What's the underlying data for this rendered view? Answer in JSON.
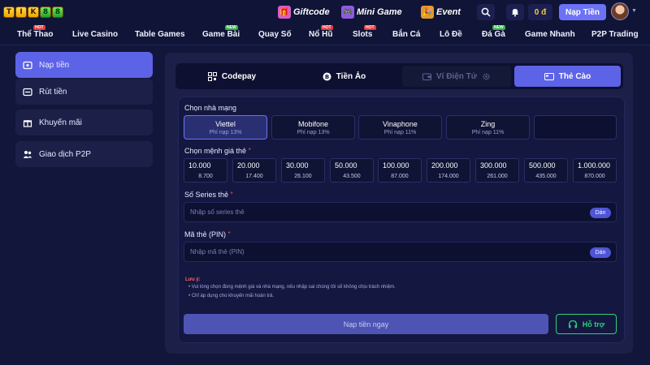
{
  "header": {
    "logo_letters": [
      "T",
      "I",
      "K",
      "8",
      "8"
    ],
    "promos": [
      {
        "label": "Giftcode",
        "icon": "gift-icon"
      },
      {
        "label": "Mini Game",
        "icon": "arcade-icon"
      },
      {
        "label": "Event",
        "icon": "event-icon"
      }
    ],
    "balance": "0 đ",
    "deposit_label": "Nạp Tiền"
  },
  "nav": {
    "items": [
      {
        "label": "Thể Thao",
        "badge": "HOT"
      },
      {
        "label": "Live Casino",
        "badge": ""
      },
      {
        "label": "Table Games",
        "badge": ""
      },
      {
        "label": "Game Bài",
        "badge": "NEW"
      },
      {
        "label": "Quay Số",
        "badge": ""
      },
      {
        "label": "Nổ Hũ",
        "badge": "HOT"
      },
      {
        "label": "Slots",
        "badge": "HOT"
      },
      {
        "label": "Bắn Cá",
        "badge": ""
      },
      {
        "label": "Lô Đề",
        "badge": ""
      },
      {
        "label": "Đá Gà",
        "badge": "NEW"
      },
      {
        "label": "Game Nhanh",
        "badge": ""
      },
      {
        "label": "P2P Trading",
        "badge": ""
      }
    ]
  },
  "sidebar": {
    "items": [
      {
        "label": "Nạp tiền",
        "icon": "wallet-icon",
        "active": true
      },
      {
        "label": "Rút tiền",
        "icon": "withdraw-icon",
        "active": false
      },
      {
        "label": "Khuyến mãi",
        "icon": "gift-box-icon",
        "active": false
      },
      {
        "label": "Giao dịch P2P",
        "icon": "p2p-icon",
        "active": false
      }
    ]
  },
  "tabs": [
    {
      "label": "Codepay",
      "icon": "qr-icon",
      "state": "normal"
    },
    {
      "label": "Tiền Ảo",
      "icon": "bitcoin-icon",
      "state": "normal"
    },
    {
      "label": "Ví Điện Tử",
      "icon": "e-wallet-icon",
      "state": "disabled"
    },
    {
      "label": "Thẻ Cào",
      "icon": "card-icon",
      "state": "active"
    }
  ],
  "form": {
    "carrier_label": "Chọn nhà mạng",
    "carriers": [
      {
        "name": "Viettel",
        "fee": "Phí nạp 13%",
        "selected": true
      },
      {
        "name": "Mobifone",
        "fee": "Phí nạp 13%",
        "selected": false
      },
      {
        "name": "Vinaphone",
        "fee": "Phí nạp 11%",
        "selected": false
      },
      {
        "name": "Zing",
        "fee": "Phí nạp 11%",
        "selected": false
      },
      {
        "name": "",
        "fee": "",
        "selected": false
      }
    ],
    "amount_label": "Chọn mệnh giá thẻ",
    "amounts": [
      {
        "value": "10.000",
        "receive": "8.700"
      },
      {
        "value": "20.000",
        "receive": "17.400"
      },
      {
        "value": "30.000",
        "receive": "26.100"
      },
      {
        "value": "50.000",
        "receive": "43.500"
      },
      {
        "value": "100.000",
        "receive": "87.000"
      },
      {
        "value": "200.000",
        "receive": "174.000"
      },
      {
        "value": "300.000",
        "receive": "261.000"
      },
      {
        "value": "500.000",
        "receive": "435.000"
      },
      {
        "value": "1.000.000",
        "receive": "870.000"
      }
    ],
    "serial_label": "Số Series thẻ",
    "serial_placeholder": "Nhập số series thẻ",
    "pin_label": "Mã thẻ (PIN)",
    "pin_placeholder": "Nhập mã thẻ (PIN)",
    "paste_label": "Dán",
    "required_mark": "*",
    "note_title": "Lưu ý:",
    "notes": [
      "Vui lòng chọn đúng mệnh giá và nhà mạng, nếu nhập sai chúng tôi sẽ không chịu trách nhiệm.",
      "Chỉ áp dụng cho khuyến mãi hoàn trả."
    ],
    "submit_label": "Nạp tiền ngay",
    "support_label": "Hỗ trợ"
  },
  "colors": {
    "accent": "#5d63e6",
    "background": "#12163a",
    "panel": "#1c2048",
    "support_green": "#2fd07e",
    "required_red": "#ff4d4d"
  }
}
